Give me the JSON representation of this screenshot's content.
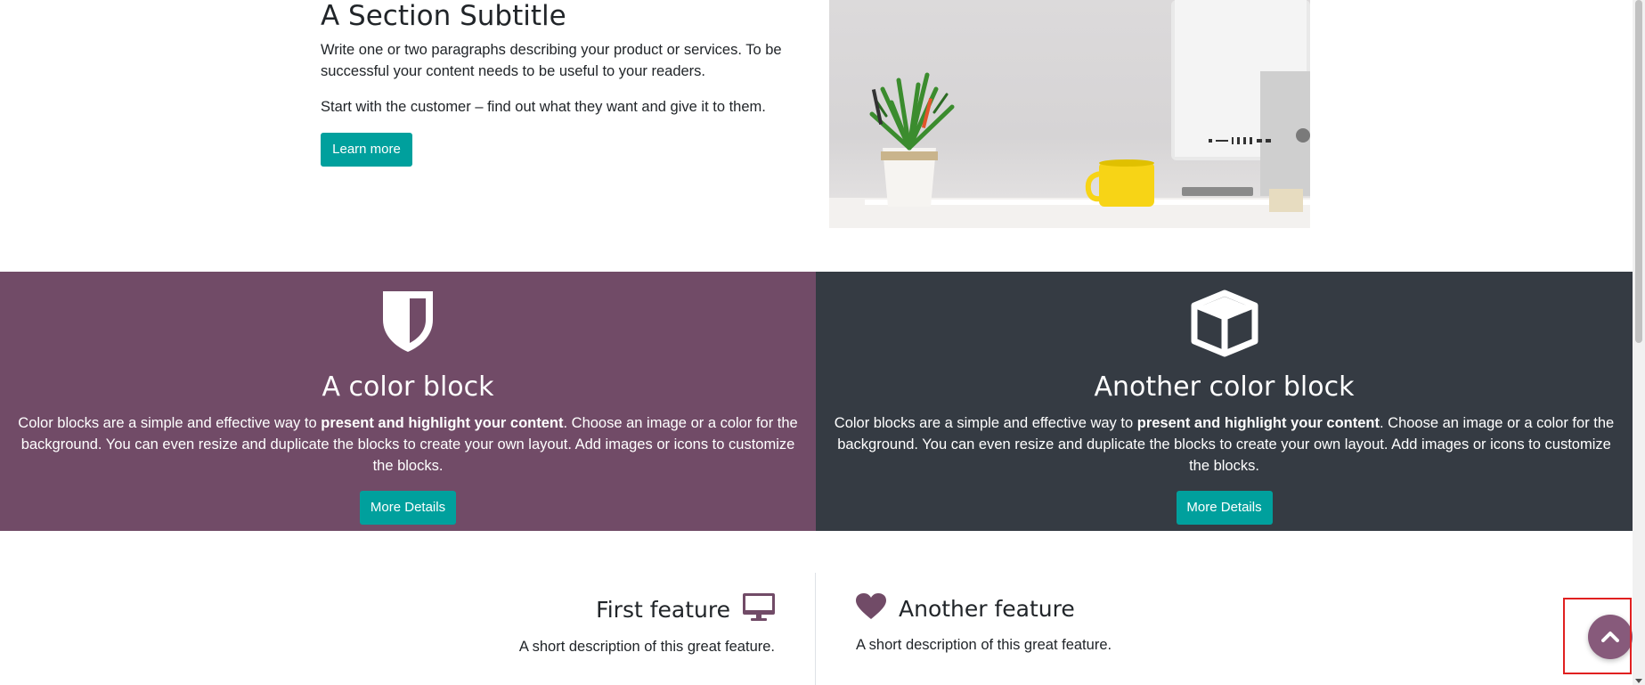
{
  "intro": {
    "subtitle": "A Section Subtitle",
    "paragraph1": "Write one or two paragraphs describing your product or services. To be successful your content needs to be useful to your readers.",
    "paragraph2": "Start with the customer – find out what they want and give it to them.",
    "button_label": "Learn more"
  },
  "color_blocks": [
    {
      "icon": "shield-icon",
      "title": "A color block",
      "desc_before": "Color blocks are a simple and effective way to ",
      "desc_bold": "present and highlight your content",
      "desc_after": ". Choose an image or a color for the background. You can even resize and duplicate the blocks to create your own layout. Add images or icons to customize the blocks.",
      "button_label": "More Details",
      "background": "#714b67"
    },
    {
      "icon": "cube-icon",
      "title": "Another color block",
      "desc_before": "Color blocks are a simple and effective way to ",
      "desc_bold": "present and highlight your content",
      "desc_after": ". Choose an image or a color for the background. You can even resize and duplicate the blocks to create your own layout. Add images or icons to customize the blocks.",
      "button_label": "More Details",
      "background": "#353b43"
    }
  ],
  "features": [
    {
      "icon": "desktop-icon",
      "title": "First feature",
      "description": "A short description of this great feature."
    },
    {
      "icon": "heart-icon",
      "title": "Another feature",
      "description": "A short description of this great feature."
    }
  ],
  "scroll_top": {
    "icon": "chevron-up-icon"
  },
  "colors": {
    "accent": "#00a09d",
    "brand_purple": "#714b67",
    "dark_block": "#353b43",
    "scroll_button": "#875a7b"
  }
}
